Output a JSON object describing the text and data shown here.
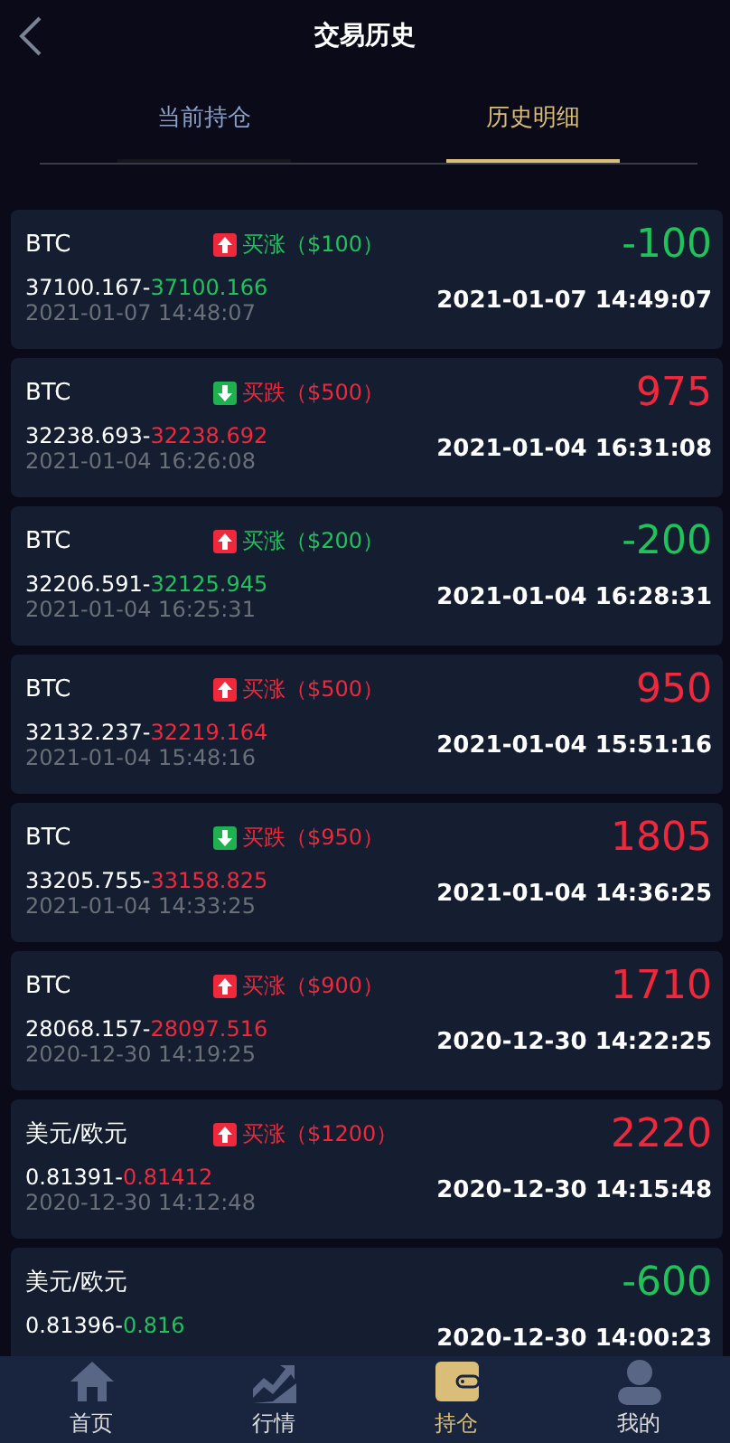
{
  "header": {
    "title": "交易历史"
  },
  "tabs": [
    {
      "label": "当前持仓",
      "selected": false
    },
    {
      "label": "历史明细",
      "selected": true
    }
  ],
  "trades": [
    {
      "symbol": "BTC",
      "rising": true,
      "order": "买涨（$100）",
      "loss": true,
      "open_price": "37100.167-",
      "close_price": "37100.166",
      "open_time": "2021-01-07 14:48:07",
      "profit": "-100",
      "close_time": "2021-01-07 14:49:07"
    },
    {
      "symbol": "BTC",
      "rising": false,
      "order": "买跌（$500）",
      "loss": false,
      "open_price": "32238.693-",
      "close_price": "32238.692",
      "open_time": "2021-01-04 16:26:08",
      "profit": "975",
      "close_time": "2021-01-04 16:31:08"
    },
    {
      "symbol": "BTC",
      "rising": true,
      "order": "买涨（$200）",
      "loss": true,
      "open_price": "32206.591-",
      "close_price": "32125.945",
      "open_time": "2021-01-04 16:25:31",
      "profit": "-200",
      "close_time": "2021-01-04 16:28:31"
    },
    {
      "symbol": "BTC",
      "rising": true,
      "order": "买涨（$500）",
      "loss": false,
      "open_price": "32132.237-",
      "close_price": "32219.164",
      "open_time": "2021-01-04 15:48:16",
      "profit": "950",
      "close_time": "2021-01-04 15:51:16"
    },
    {
      "symbol": "BTC",
      "rising": false,
      "order": "买跌（$950）",
      "loss": false,
      "open_price": "33205.755-",
      "close_price": "33158.825",
      "open_time": "2021-01-04 14:33:25",
      "profit": "1805",
      "close_time": "2021-01-04 14:36:25"
    },
    {
      "symbol": "BTC",
      "rising": true,
      "order": "买涨（$900）",
      "loss": false,
      "open_price": "28068.157-",
      "close_price": "28097.516",
      "open_time": "2020-12-30 14:19:25",
      "profit": "1710",
      "close_time": "2020-12-30 14:22:25"
    },
    {
      "symbol": "美元/欧元",
      "rising": true,
      "order": "买涨（$1200）",
      "loss": false,
      "open_price": "0.81391-",
      "close_price": "0.81412",
      "open_time": "2020-12-30 14:12:48",
      "profit": "2220",
      "close_time": "2020-12-30 14:15:48"
    },
    {
      "symbol": "美元/欧元",
      "loss": true,
      "open_price": "0.81396-",
      "close_price": "0.816",
      "profit": "-600",
      "close_time": "2020-12-30 14:00:23"
    }
  ],
  "nav": [
    {
      "kind": "home",
      "label": "首页",
      "selected": false
    },
    {
      "kind": "market",
      "label": "行情",
      "selected": false
    },
    {
      "kind": "wallet",
      "label": "持仓",
      "selected": true
    },
    {
      "kind": "profile",
      "label": "我的",
      "selected": false
    }
  ]
}
